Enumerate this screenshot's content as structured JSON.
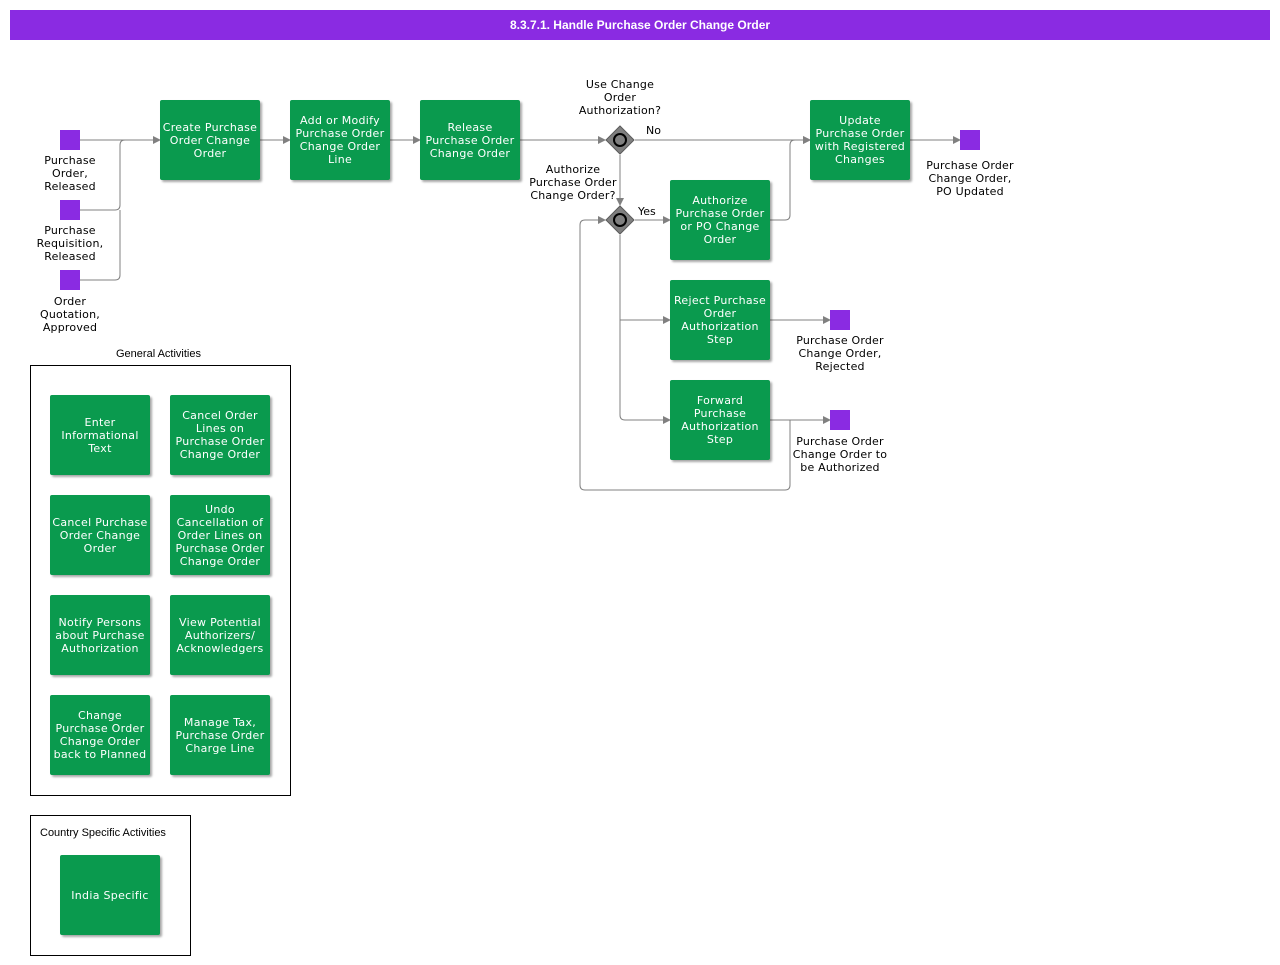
{
  "title": "8.3.7.1. Handle Purchase Order Change Order",
  "events": {
    "po_released": "Purchase Order, Released",
    "req_released": "Purchase Requisition, Released",
    "quote_approved": "Order Quotation, Approved",
    "po_updated": "Purchase Order Change Order, PO Updated",
    "rejected": "Purchase Order Change Order, Rejected",
    "to_authorize": "Purchase Order Change Order to be Authorized"
  },
  "activities": {
    "create": "Create Purchase Order Change Order",
    "add_modify": "Add or Modify Purchase Order Change Order Line",
    "release": "Release Purchase Order Change Order",
    "update": "Update Purchase Order with Registered Changes",
    "authorize": "Authorize Purchase Order or PO Change Order",
    "reject": "Reject Purchase Order Authorization Step",
    "forward": "Forward Purchase Authorization Step"
  },
  "gateways": {
    "use_change_auth": "Use Change Order Authorization?",
    "authorize_q": "Authorize Purchase Order Change Order?",
    "no_label": "No",
    "yes_label": "Yes"
  },
  "general": {
    "title": "General Activities",
    "items": [
      "Enter Informational Text",
      "Cancel Order Lines on Purchase Order Change Order",
      "Cancel Purchase Order Change Order",
      "Undo Cancellation of Order Lines on Purchase Order Change Order",
      "Notify Persons about Purchase Authorization",
      "View Potential Authorizers/ Acknowledgers",
      "Change Purchase Order Change Order back to Planned",
      "Manage Tax, Purchase Order Charge Line"
    ]
  },
  "country": {
    "title": "Country Specific Activities",
    "items": [
      "India Specific"
    ]
  },
  "colors": {
    "activity": "#0a9a4e",
    "event": "#8a2be2",
    "title_bar": "#8a2be2",
    "connector": "#808080",
    "gateway": "#808080"
  }
}
